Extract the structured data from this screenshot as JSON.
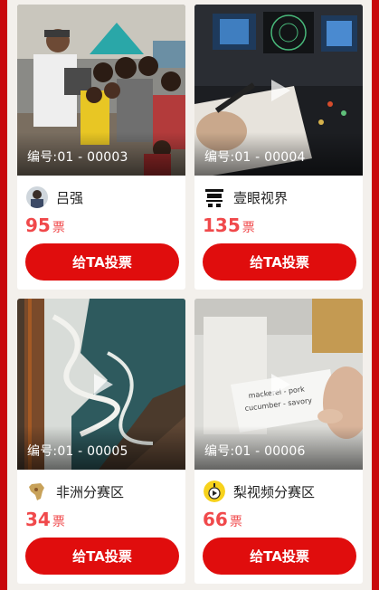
{
  "colors": {
    "accent": "#e00d0d",
    "votes": "#f0494b",
    "frame": "#c8080c"
  },
  "vote_button_label": "给TA投票",
  "vote_unit": "票",
  "entries": [
    {
      "code": "编号:01 - 00003",
      "author": "吕强",
      "votes": "95",
      "has_play_icon": false,
      "avatar_icon": "user-photo-avatar"
    },
    {
      "code": "编号:01 - 00004",
      "author": "壹眼视界",
      "votes": "135",
      "has_play_icon": true,
      "avatar_icon": "yiyan-logo-avatar"
    },
    {
      "code": "编号:01 - 00005",
      "author": "非洲分赛区",
      "votes": "34",
      "has_play_icon": true,
      "avatar_icon": "africa-map-avatar"
    },
    {
      "code": "编号:01 - 00006",
      "author": "梨视频分赛区",
      "votes": "66",
      "has_play_icon": true,
      "avatar_icon": "pear-video-avatar"
    }
  ]
}
